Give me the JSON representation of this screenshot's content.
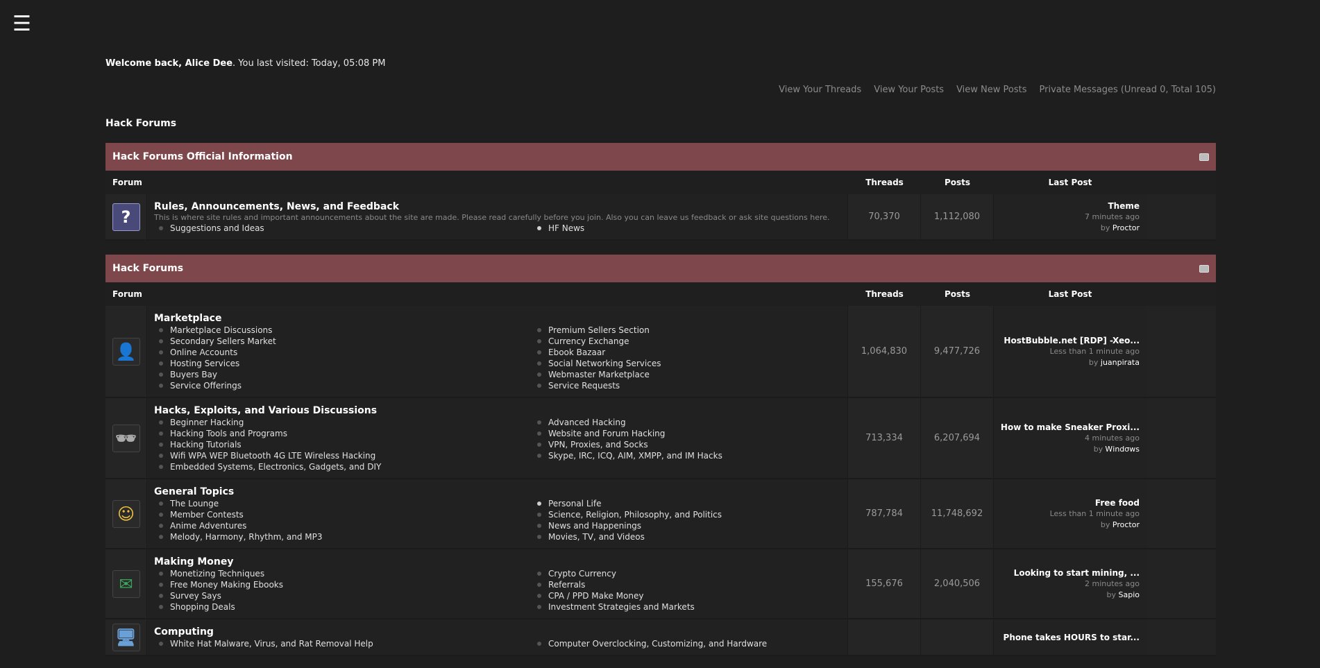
{
  "menu_icon": "hamburger-icon",
  "welcome": {
    "greeting": "Welcome back, Alice Dee",
    "rest": ". You last visited: Today, 05:08 PM"
  },
  "userlinks": {
    "threads": "View Your Threads",
    "posts": "View Your Posts",
    "new_posts": "View New Posts",
    "pm": "Private Messages (Unread 0, Total 105)"
  },
  "breadcrumb": "Hack Forums",
  "headers": {
    "forum": "Forum",
    "threads": "Threads",
    "posts": "Posts",
    "last_post": "Last Post"
  },
  "categories": [
    {
      "title": "Hack Forums Official Information",
      "forums": [
        {
          "icon": "question-icon",
          "title": "Rules, Announcements, News, and Feedback",
          "description": "This is where site rules and important announcements about the site are made. Please read carefully before you join. Also you can leave us feedback or ask site questions here.",
          "subs_left": [
            "Suggestions and Ideas"
          ],
          "subs_right": [
            "HF News"
          ],
          "threads": "70,370",
          "posts": "1,112,080",
          "last_title": "Theme",
          "last_time": "7 minutes ago",
          "last_by": "Proctor"
        }
      ]
    },
    {
      "title": "Hack Forums",
      "forums": [
        {
          "icon": "businessman-icon",
          "title": "Marketplace",
          "description": "",
          "subs_left": [
            "Marketplace Discussions",
            "Secondary Sellers Market",
            "Online Accounts",
            "Hosting Services",
            "Buyers Bay",
            "Service Offerings"
          ],
          "subs_right": [
            "Premium Sellers Section",
            "Currency Exchange",
            "Ebook Bazaar",
            "Social Networking Services",
            "Webmaster Marketplace",
            "Service Requests"
          ],
          "threads": "1,064,830",
          "posts": "9,477,726",
          "last_title": "HostBubble.net [RDP] -Xeo...",
          "last_time": "Less than 1 minute ago",
          "last_by": "juanpirata"
        },
        {
          "icon": "hacker-icon",
          "title": "Hacks, Exploits, and Various Discussions",
          "description": "",
          "subs_left": [
            "Beginner Hacking",
            "Hacking Tools and Programs",
            "Hacking Tutorials",
            "Wifi WPA WEP Bluetooth 4G LTE Wireless Hacking",
            "Embedded Systems, Electronics, Gadgets, and DIY"
          ],
          "subs_right": [
            "Advanced Hacking",
            "Website and Forum Hacking",
            "VPN, Proxies, and Socks",
            "Skype, IRC, ICQ, AIM, XMPP, and IM Hacks"
          ],
          "threads": "713,334",
          "posts": "6,207,694",
          "last_title": "How to make Sneaker Proxi...",
          "last_time": "4 minutes ago",
          "last_by": "Ꮃindσws"
        },
        {
          "icon": "cartoon-face-icon",
          "title": "General Topics",
          "description": "",
          "subs_left": [
            "The Lounge",
            "Member Contests",
            "Anime Adventures",
            "Melody, Harmony, Rhythm, and MP3"
          ],
          "subs_right": [
            "Personal Life",
            "Science, Religion, Philosophy, and Politics",
            "News and Happenings",
            "Movies, TV, and Videos"
          ],
          "threads": "787,784",
          "posts": "11,748,692",
          "last_title": "Free food",
          "last_time": "Less than 1 minute ago",
          "last_by": "Proctor"
        },
        {
          "icon": "money-envelope-icon",
          "title": "Making Money",
          "description": "",
          "subs_left": [
            "Monetizing Techniques",
            "Free Money Making Ebooks",
            "Survey Says",
            "Shopping Deals"
          ],
          "subs_right": [
            "Crypto Currency",
            "Referrals",
            "CPA / PPD Make Money",
            "Investment Strategies and Markets"
          ],
          "threads": "155,676",
          "posts": "2,040,506",
          "last_title": "Looking to start mining, ...",
          "last_time": "2 minutes ago",
          "last_by": "Sapio"
        },
        {
          "icon": "computer-icon",
          "title": "Computing",
          "description": "",
          "subs_left": [
            "White Hat Malware, Virus, and Rat Removal Help"
          ],
          "subs_right": [
            "Computer Overclocking, Customizing, and Hardware"
          ],
          "threads": "",
          "posts": "",
          "last_title": "Phone takes HOURS to star...",
          "last_time": "",
          "last_by": ""
        }
      ]
    }
  ],
  "colors": {
    "category_bar": "#7d474b",
    "background": "#1e1e1e",
    "row": "#232323"
  }
}
